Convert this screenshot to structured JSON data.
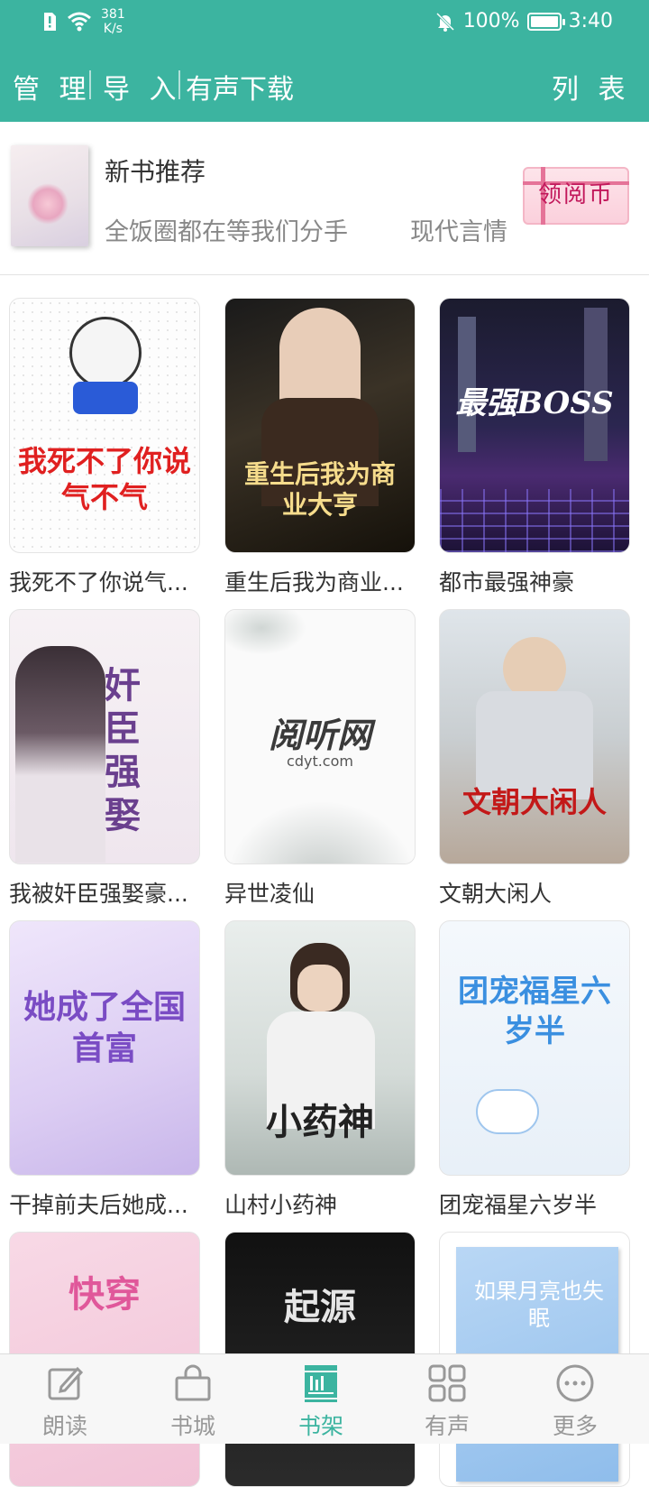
{
  "status_bar": {
    "net_speed_value": "381",
    "net_speed_unit": "K/s",
    "battery": "100%",
    "time": "3:40"
  },
  "toolbar": {
    "manage": "管 理",
    "import": "导 入",
    "audio_download": "有声下载",
    "list": "列 表"
  },
  "recommend": {
    "heading": "新书推荐",
    "book_title": "全饭圈都在等我们分手",
    "genre": "现代言情",
    "coin_button": "领阅币"
  },
  "books": [
    {
      "title": "我死不了你说气...",
      "cover_text": "我死不了你说气不气"
    },
    {
      "title": "重生后我为商业...",
      "cover_text": "重生后我为商业大亨"
    },
    {
      "title": "都市最强神豪",
      "cover_text": "最强BOSS"
    },
    {
      "title": "我被奸臣强娶豪...",
      "cover_text": "奸臣强娶"
    },
    {
      "title": "异世凌仙",
      "cover_text": "阅听网",
      "cover_sub": "cdyt.com"
    },
    {
      "title": "文朝大闲人",
      "cover_text": "文朝大闲人"
    },
    {
      "title": "干掉前夫后她成...",
      "cover_text": "她成了全国首富"
    },
    {
      "title": "山村小药神",
      "cover_text": "小药神"
    },
    {
      "title": "团宠福星六岁半",
      "cover_text": "团宠福星六岁半"
    },
    {
      "title": "",
      "cover_text": "快穿"
    },
    {
      "title": "",
      "cover_text": "起源"
    },
    {
      "title": "",
      "cover_text": "如果月亮也失眠"
    }
  ],
  "nav": {
    "read": "朗读",
    "store": "书城",
    "shelf": "书架",
    "audio": "有声",
    "more": "更多"
  },
  "colors": {
    "accent": "#3cb4a0"
  }
}
